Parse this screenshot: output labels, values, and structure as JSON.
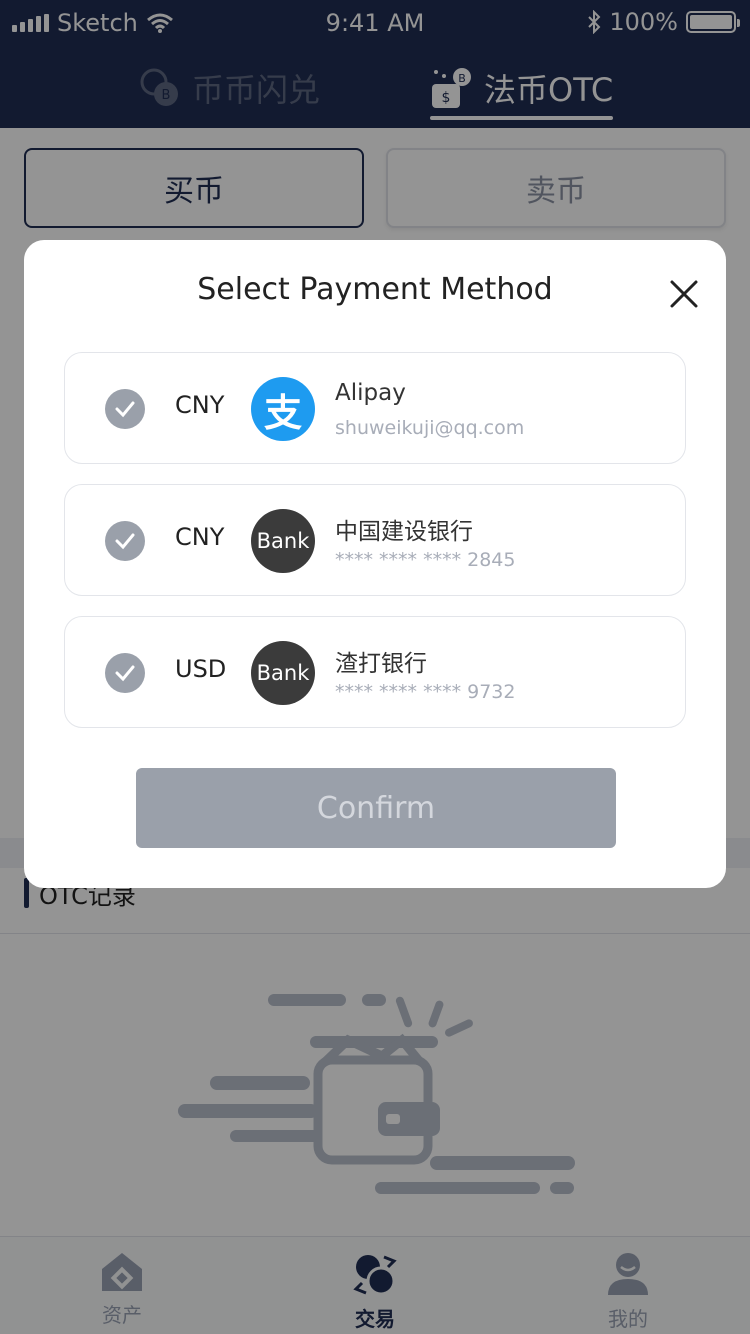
{
  "statusbar": {
    "carrier": "Sketch",
    "time": "9:41 AM",
    "battery": "100%"
  },
  "header_tabs": [
    {
      "label": "币币闪兑"
    },
    {
      "label": "法币OTC"
    }
  ],
  "trade_buttons": {
    "buy": "买币",
    "sell": "卖币"
  },
  "otc_section": {
    "title": "OTC记录"
  },
  "tabbar": [
    {
      "label": "资产"
    },
    {
      "label": "交易"
    },
    {
      "label": "我的"
    }
  ],
  "modal": {
    "title": "Select Payment Method",
    "confirm_label": "Confirm",
    "methods": [
      {
        "currency": "CNY",
        "logo_text": "支",
        "logo_icon": "alipay-icon",
        "name": "Alipay",
        "detail": "shuweikuji@qq.com",
        "checked": true
      },
      {
        "currency": "CNY",
        "logo_text": "Bank",
        "logo_icon": "bank-icon",
        "name": "中国建设银行",
        "detail": "**** **** **** 2845",
        "checked": true
      },
      {
        "currency": "USD",
        "logo_text": "Bank",
        "logo_icon": "bank-icon",
        "name": "渣打银行",
        "detail": "**** **** **** 9732",
        "checked": true
      }
    ]
  },
  "colors": {
    "navy": "#1f2d53",
    "alipay_blue": "#1e9bf0",
    "check_gray": "#9aa0aa",
    "bank_dark": "#3b3b3b"
  }
}
